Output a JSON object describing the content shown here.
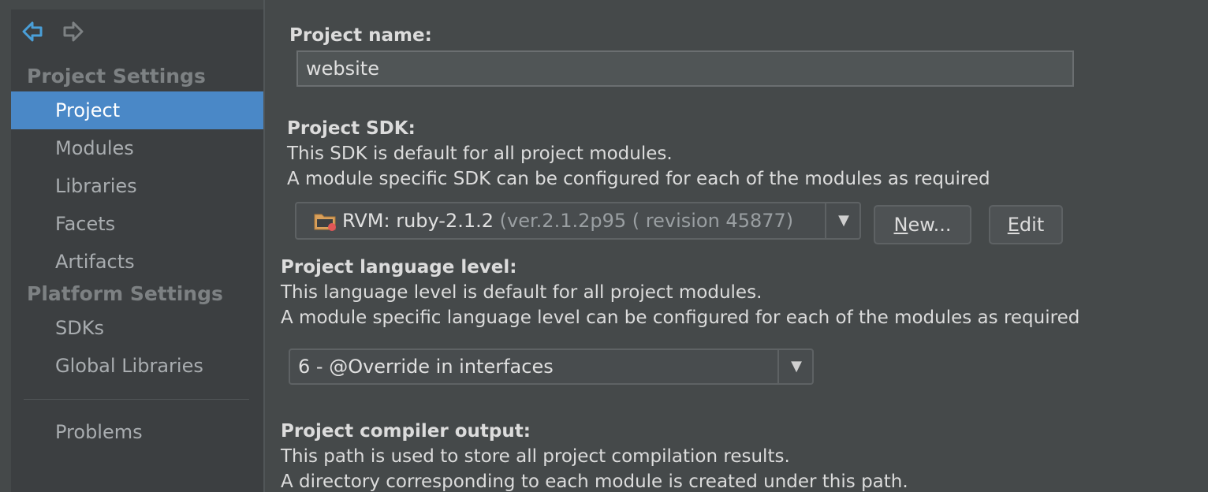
{
  "sidebar": {
    "project_settings_header": "Project Settings",
    "platform_settings_header": "Platform Settings",
    "items": [
      {
        "label": "Project",
        "selected": true
      },
      {
        "label": "Modules"
      },
      {
        "label": "Libraries"
      },
      {
        "label": "Facets"
      },
      {
        "label": "Artifacts"
      }
    ],
    "platform_items": [
      {
        "label": "SDKs"
      },
      {
        "label": "Global Libraries"
      }
    ],
    "problems_label": "Problems",
    "back_icon": "arrow-left-icon",
    "forward_icon": "arrow-right-icon"
  },
  "main": {
    "project_name": {
      "label": "Project name:",
      "value": "website"
    },
    "sdk": {
      "label": "Project SDK:",
      "desc1": "This SDK is default for all project modules.",
      "desc2": "A module specific SDK can be configured for each of the modules as required",
      "selected_name": "RVM: ruby-2.1.2",
      "selected_version": "(ver.2.1.2p95 ( revision 45877)",
      "new_button_mnemonic": "N",
      "new_button_rest": "ew...",
      "edit_button_mnemonic": "E",
      "edit_button_rest": "dit"
    },
    "language_level": {
      "label": "Project language level:",
      "desc1": "This language level is default for all project modules.",
      "desc2": "A module specific language level can be configured for each of the modules as required",
      "selected": "6 - @Override in interfaces"
    },
    "compiler_output": {
      "label": "Project compiler output:",
      "desc1": "This path is used to store all project compilation results.",
      "desc2": "A directory corresponding to each module is created under this path."
    }
  },
  "colors": {
    "selection": "#4a88c7",
    "background": "#45494a",
    "sidebar": "#3c3f41",
    "back_arrow": "#4a9fd8"
  }
}
